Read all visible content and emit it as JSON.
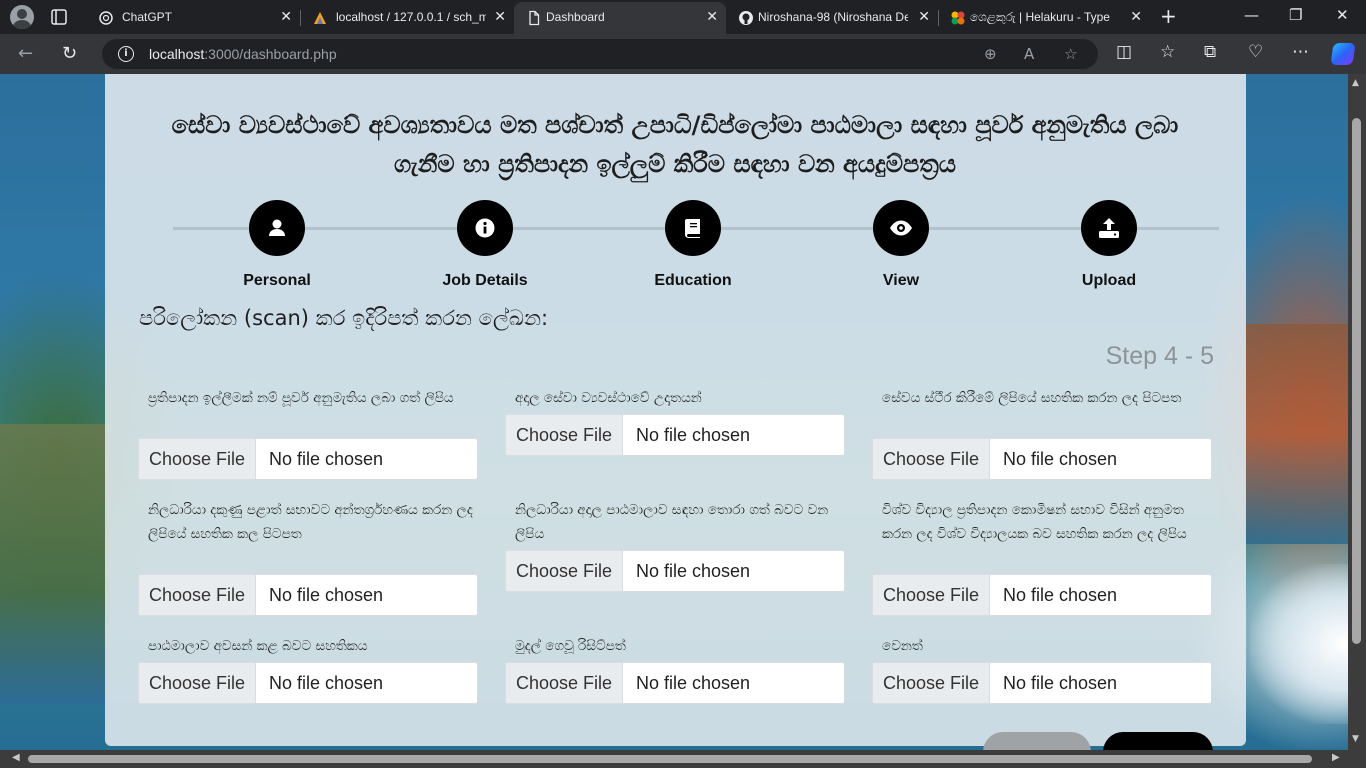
{
  "browser": {
    "tabs": [
      {
        "title": "ChatGPT",
        "active": false
      },
      {
        "title": "localhost / 127.0.0.1 / sch_m",
        "active": false
      },
      {
        "title": "Dashboard",
        "active": true
      },
      {
        "title": "Niroshana-98 (Niroshana De",
        "active": false
      },
      {
        "title": "ශෙළකුරු | Helakuru - Type",
        "active": false
      }
    ],
    "close_glyph": "✕",
    "new_tab_glyph": "+",
    "url_host": "localhost",
    "url_path": ":3000/dashboard.php",
    "window_controls": {
      "minimize": "—",
      "maximize": "❐",
      "close": "✕"
    }
  },
  "page": {
    "heading": "සේවා ව්‍යවස්ථාවේ අවශ්‍යතාවය මත පශ්චාත් උපාධි/ඩිප්ලෝමා පාඨමාලා සඳහා පූර්ව අනුමැතිය ලබා ගැනීම හා ප්‍රතිපාදන ඉල්ලුම් කිරීම සඳහා වන අයදුම්පත්‍රය",
    "steps": [
      {
        "label": "Personal",
        "icon": "user-icon"
      },
      {
        "label": "Job Details",
        "icon": "info-icon"
      },
      {
        "label": "Education",
        "icon": "book-icon"
      },
      {
        "label": "View",
        "icon": "eye-icon"
      },
      {
        "label": "Upload",
        "icon": "upload-icon"
      }
    ],
    "section_title": "පරිලෝකන (scan) කර ඉදිරිපත් කරන ලේඛන:",
    "step_indicator": "Step 4 - 5",
    "file_button_label": "Choose File",
    "file_status": "No file chosen",
    "fields": [
      {
        "label": "ප්‍රතිපාදන ඉල්ලීමක් නම් පූර්ව අනුමැතිය ලබා ගත් ලිපිය"
      },
      {
        "label": "අදාල සේවා ව්‍යවස්ථාවේ උදෘතයන්"
      },
      {
        "label": "සේවය ස්ථීර කිරීමේ ලිපියේ සහතික කරන ලද පිටපත"
      },
      {
        "label": "නිලධාරියා දකුණු පළාත් සභාවට අන්තර්ග්‍රහණය කරන ලද ලිපියේ සහතික කල පිටපත"
      },
      {
        "label": "නිලධාරියා අදාල පාඨමාලාව සඳහා තොරා ගත් බවට වන ලිපිය"
      },
      {
        "label": "විශ්ව විද්‍යාල ප්‍රතිපාදන කොමිෂන් සභාව විසින් අනුමත කරන ලද විශ්ව විද්‍යාලයක බව සහතික කරන ලද ලිපිය"
      },
      {
        "label": "පාඨමාලාව අවසන් කළ බවට සහතිකය"
      },
      {
        "label": "මුදල් ගෙවූ රිසිට්පත්"
      },
      {
        "label": "වෙනත්"
      }
    ]
  }
}
